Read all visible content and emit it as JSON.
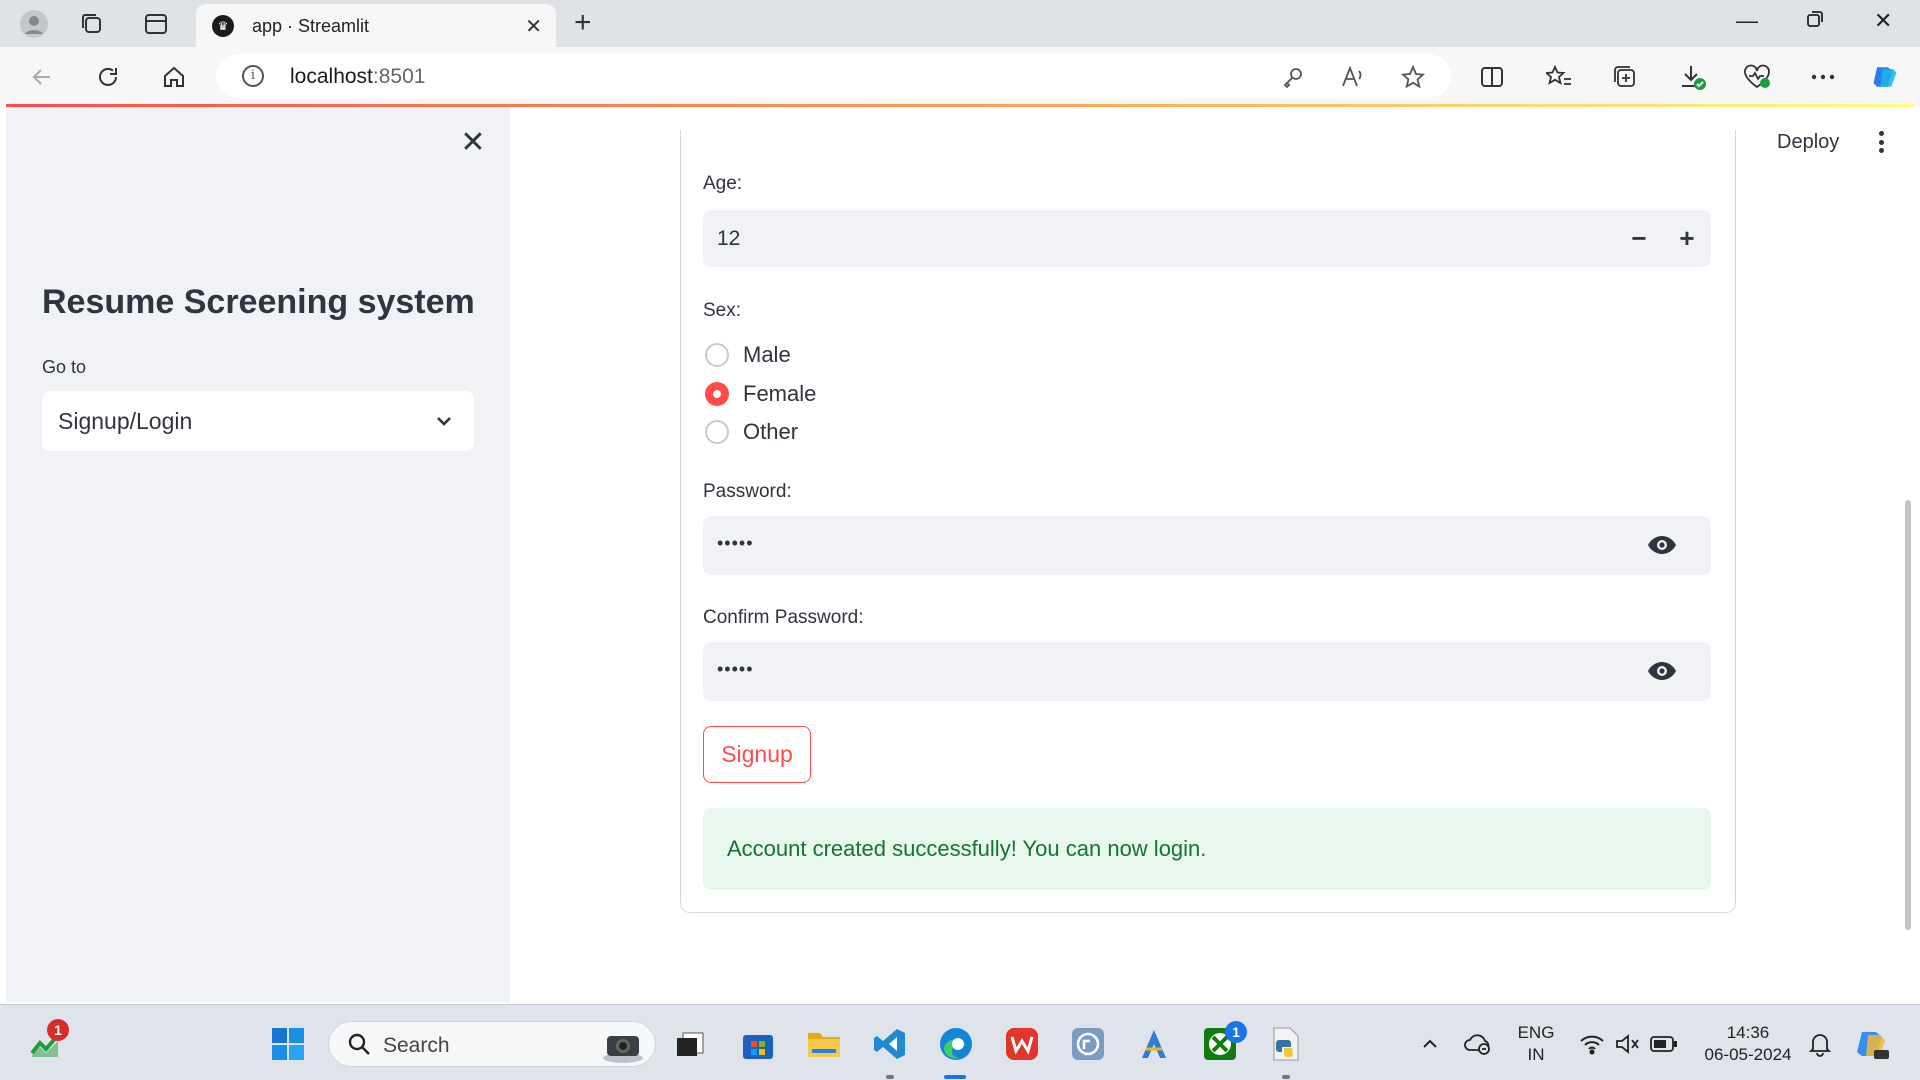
{
  "browser": {
    "tab_title": "app · Streamlit",
    "url_host": "localhost",
    "url_port": ":8501"
  },
  "header": {
    "deploy_label": "Deploy"
  },
  "sidebar": {
    "title": "Resume Screening system",
    "nav_label": "Go to",
    "nav_selected": "Signup/Login"
  },
  "form": {
    "age_label": "Age:",
    "age_value": "12",
    "sex_label": "Sex:",
    "sex_options": [
      "Male",
      "Female",
      "Other"
    ],
    "sex_selected": "Female",
    "password_label": "Password:",
    "password_value": "•••••",
    "confirm_label": "Confirm Password:",
    "confirm_value": "•••••",
    "signup_button": "Signup",
    "success_message": "Account created successfully! You can now login."
  },
  "taskbar": {
    "search_placeholder": "Search",
    "lang_line1": "ENG",
    "lang_line2": "IN",
    "time": "14:36",
    "date": "06-05-2024",
    "stocks_badge": "1",
    "xbox_badge": "1"
  },
  "colors": {
    "accent": "#ff4b4b",
    "success_bg": "#e9f8ef",
    "success_text": "#177233",
    "sidebar_bg": "#f0f2f6"
  }
}
